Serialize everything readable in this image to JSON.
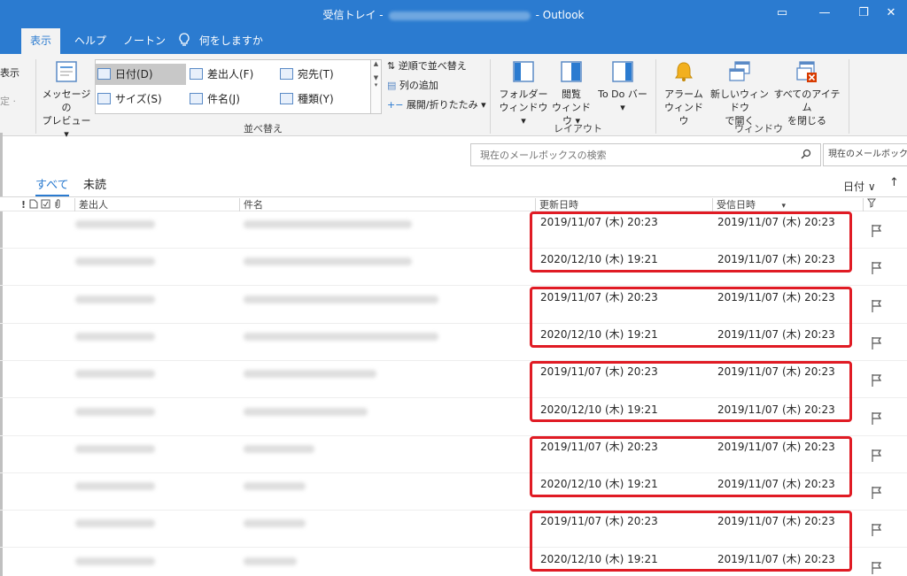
{
  "window": {
    "title_left": "受信トレイ -",
    "title_right": "- Outlook",
    "btn_ribbon_display": "▭",
    "btn_minimize": "—",
    "btn_restore": "❐",
    "btn_close": "✕"
  },
  "tabs": {
    "display": "表示",
    "help": "ヘルプ",
    "norton": "ノートン",
    "tell_me": "何をしますか"
  },
  "ribbon": {
    "cut_display": "表示",
    "cut_settings": "定 ·",
    "message_preview_line1": "メッセージの",
    "message_preview_line2": "プレビュー ▾",
    "arrange": {
      "date": "日付(D)",
      "from": "差出人(F)",
      "to": "宛先(T)",
      "size": "サイズ(S)",
      "subject": "件名(J)",
      "type": "種類(Y)",
      "reverse_sort": "逆順で並べ替え",
      "add_columns": "列の追加",
      "expand_collapse": "展開/折りたたみ ▾",
      "group_label": "並べ替え"
    },
    "layout": {
      "folder_pane_line1": "フォルダー",
      "folder_pane_line2": "ウィンドウ ▾",
      "reading_pane_line1": "閲覧",
      "reading_pane_line2": "ウィンドウ ▾",
      "todo_bar_line1": "To Do バー",
      "todo_bar_line2": "▾",
      "group_label": "レイアウト"
    },
    "window": {
      "reminders_line1": "アラーム",
      "reminders_line2": "ウィンドウ",
      "open_new_line1": "新しいウィンドウ",
      "open_new_line2": "で開く",
      "close_all_line1": "すべてのアイテム",
      "close_all_line2": "を閉じる",
      "group_label": "ウィンドウ"
    }
  },
  "search": {
    "placeholder": "現在のメールボックスの検索",
    "scope": "現在のメールボックス"
  },
  "filters": {
    "all": "すべて",
    "unread": "未読",
    "sort_by": "日付 ∨",
    "sort_dir": "↑"
  },
  "columns": {
    "icons": "!",
    "sender": "差出人",
    "subject": "件名",
    "modified": "更新日時",
    "received": "受信日時",
    "received_sort": "▾"
  },
  "rows": [
    {
      "modified": "2019/11/07 (木) 20:23",
      "received": "2019/11/07 (木) 20:23",
      "subject_w": 190
    },
    {
      "modified": "2020/12/10 (木) 19:21",
      "received": "2019/11/07 (木) 20:23",
      "subject_w": 190
    },
    {
      "modified": "2019/11/07 (木) 20:23",
      "received": "2019/11/07 (木) 20:23",
      "subject_w": 220
    },
    {
      "modified": "2020/12/10 (木) 19:21",
      "received": "2019/11/07 (木) 20:23",
      "subject_w": 220
    },
    {
      "modified": "2019/11/07 (木) 20:23",
      "received": "2019/11/07 (木) 20:23",
      "subject_w": 150
    },
    {
      "modified": "2020/12/10 (木) 19:21",
      "received": "2019/11/07 (木) 20:23",
      "subject_w": 140
    },
    {
      "modified": "2019/11/07 (木) 20:23",
      "received": "2019/11/07 (木) 20:23",
      "subject_w": 80
    },
    {
      "modified": "2020/12/10 (木) 19:21",
      "received": "2019/11/07 (木) 20:23",
      "subject_w": 70
    },
    {
      "modified": "2019/11/07 (木) 20:23",
      "received": "2019/11/07 (木) 20:23",
      "subject_w": 70
    },
    {
      "modified": "2020/12/10 (木) 19:21",
      "received": "2019/11/07 (木) 20:23",
      "subject_w": 60
    }
  ],
  "colors": {
    "accent": "#2b7bd0",
    "highlight": "#e01b24"
  }
}
